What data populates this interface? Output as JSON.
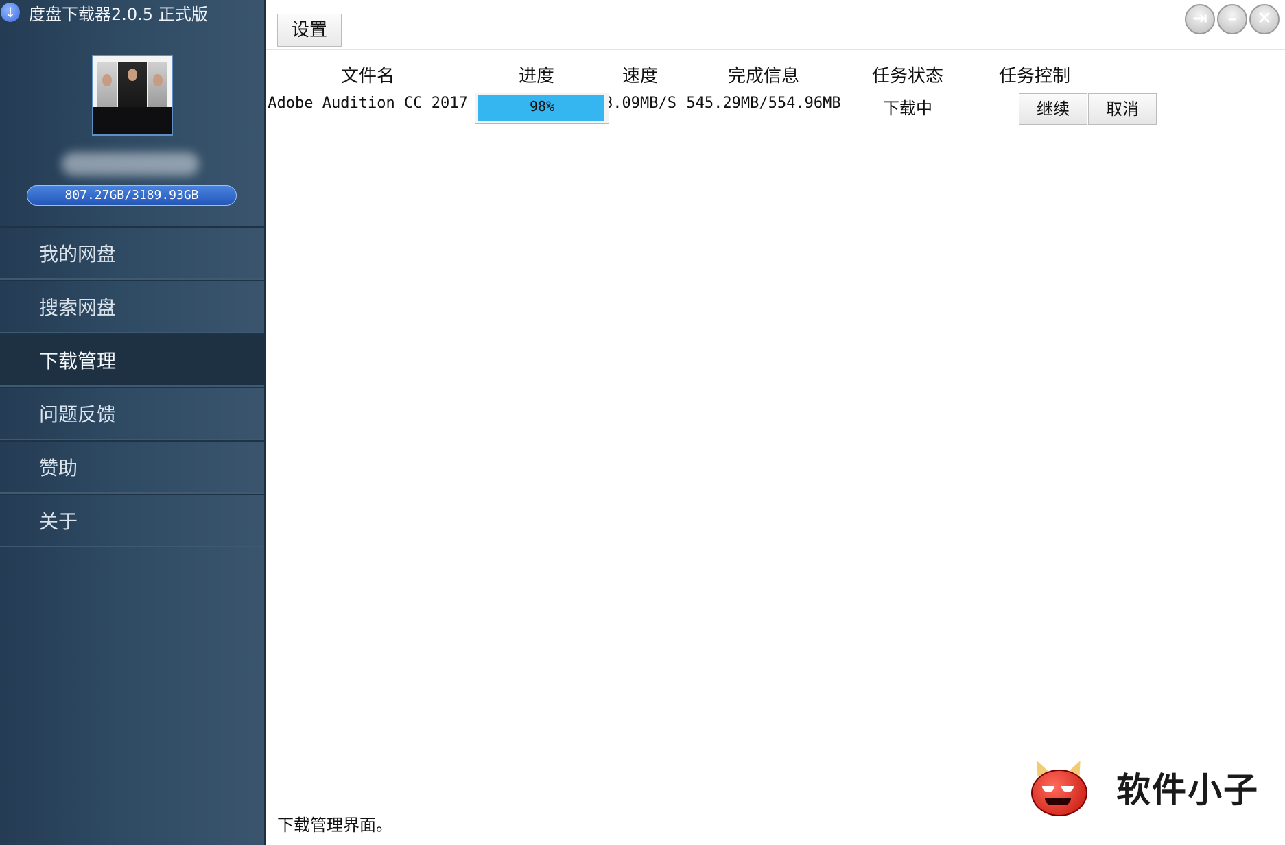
{
  "app": {
    "title": "度盘下载器2.0.5 正式版",
    "icon": "download-arrow-icon"
  },
  "user": {
    "quota": "807.27GB/3189.93GB"
  },
  "sidebar": {
    "items": [
      {
        "label": "我的网盘",
        "active": false
      },
      {
        "label": "搜索网盘",
        "active": false
      },
      {
        "label": "下载管理",
        "active": true
      },
      {
        "label": "问题反馈",
        "active": false
      },
      {
        "label": "赞助",
        "active": false
      },
      {
        "label": "关于",
        "active": false
      }
    ]
  },
  "toolbar": {
    "settings_label": "设置"
  },
  "window_controls": {
    "logout": "logout-icon",
    "minimize": "minimize-icon",
    "close": "close-icon"
  },
  "table": {
    "headers": [
      "文件名",
      "进度",
      "速度",
      "完成信息",
      "任务状态",
      "任务控制"
    ],
    "rows": [
      {
        "name": "Adobe Audition CC 2017",
        "progress_text": "98%",
        "progress_value": 0.98,
        "speed": "8.09MB/S",
        "done": "545.29MB/554.96MB",
        "status": "下载中",
        "actions": [
          "继续",
          "取消"
        ]
      }
    ]
  },
  "status_bar": {
    "text": "下载管理界面。"
  },
  "watermark": {
    "text": "软件小子",
    "icon": "devil-face-icon"
  },
  "colors": {
    "progress": "#35b6f0",
    "sidebar": "#2f4a63",
    "quota_badge": "#2f66c8"
  }
}
